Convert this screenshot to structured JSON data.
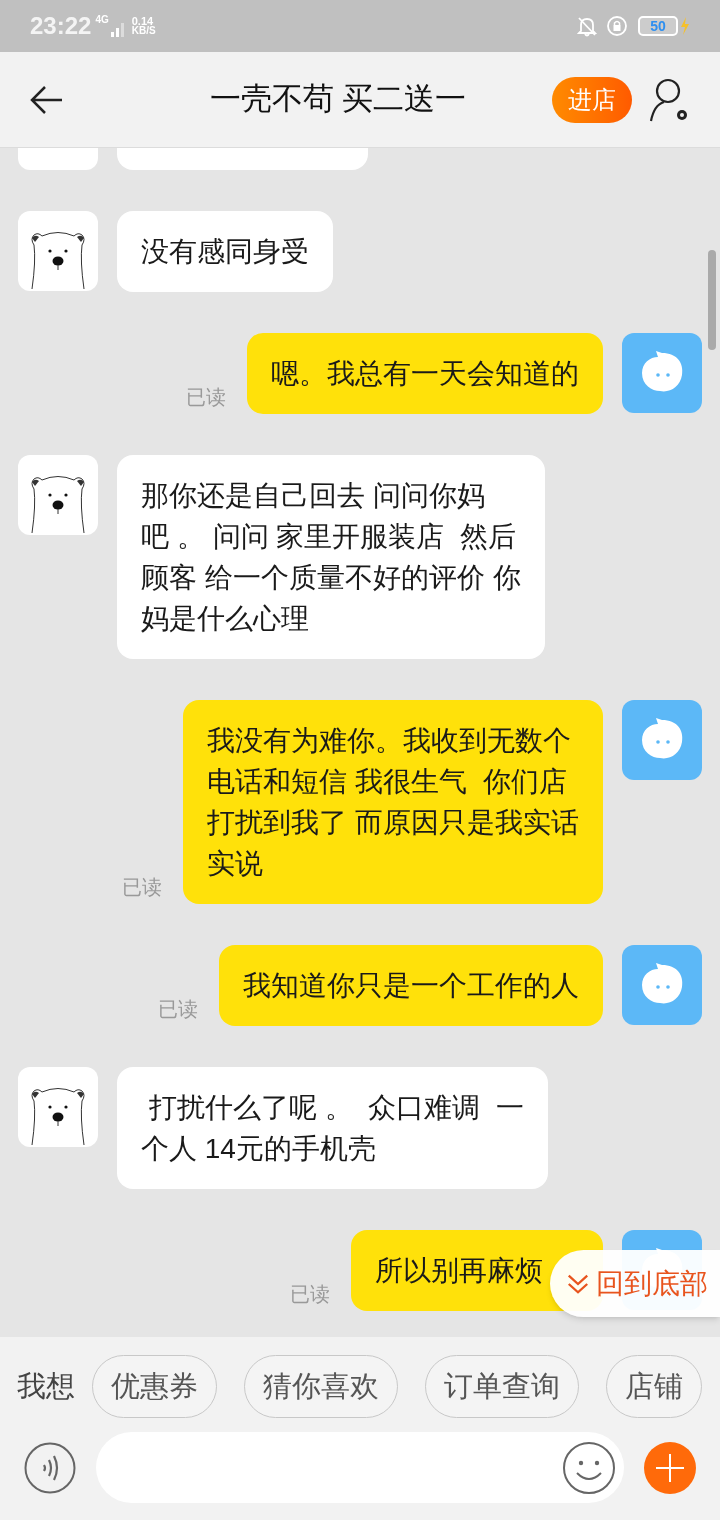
{
  "status_bar": {
    "time": "23:22",
    "network": "4G",
    "speed_value": "0.14",
    "speed_unit": "KB/S",
    "battery": "50",
    "charging": true
  },
  "header": {
    "title": "一壳不苟 买二送一",
    "shop_button": "进店"
  },
  "messages": [
    {
      "kind": "incoming",
      "lines": [
        "没有感同身受"
      ]
    },
    {
      "kind": "outgoing",
      "lines": [
        "嗯。我总有一天会知道的"
      ],
      "read_label": "已读"
    },
    {
      "kind": "incoming",
      "lines": [
        "那你还是自己回去 问问你妈",
        "吧 。 问问 家里开服装店  然后",
        "顾客 给一个质量不好的评价 你",
        "妈是什么心理"
      ]
    },
    {
      "kind": "outgoing",
      "lines": [
        "我没有为难你。我收到无数个",
        "电话和短信 我很生气  你们店",
        "打扰到我了 而原因只是我实话",
        "实说"
      ],
      "read_label": "已读"
    },
    {
      "kind": "outgoing",
      "lines": [
        "我知道你只是一个工作的人"
      ],
      "read_label": "已读"
    },
    {
      "kind": "incoming",
      "lines": [
        " 打扰什么了呢 。  众口难调  一",
        "个人 14元的手机壳"
      ]
    },
    {
      "kind": "outgoing",
      "lines": [
        "所以别再麻烦"
      ],
      "read_label": "已读"
    }
  ],
  "jump_to_bottom": "回到底部",
  "quick_replies": {
    "label": "我想",
    "chips": [
      "优惠券",
      "猜你喜欢",
      "订单查询",
      "店铺"
    ]
  }
}
